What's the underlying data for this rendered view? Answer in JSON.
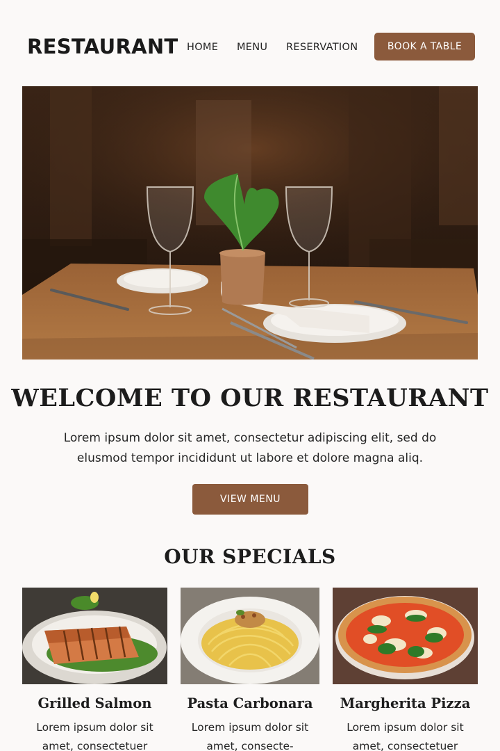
{
  "header": {
    "logo": "RESTAURANT",
    "nav": {
      "home": "HOME",
      "menu": "MENU",
      "reservation": "RESERVATION"
    },
    "book_label": "BOOK A TABLE"
  },
  "welcome": {
    "title": "WELCOME TO OUR RESTAURANT",
    "text": "Lorem ipsum dolor sit amet, consectetur adipiscing elit, sed do elusmod tempor incididunt ut labore et dolore magna aliq.",
    "button": "VIEW MENU"
  },
  "specials": {
    "title": "OUR SPECIALS",
    "items": [
      {
        "name": "Grilled Salmon",
        "desc": "Lorem ipsum dolor sit amet, consectetuer"
      },
      {
        "name": "Pasta Carbonara",
        "desc": "Lorem ipsum dolor sit amet, consecte-"
      },
      {
        "name": "Margherita Pizza",
        "desc": "Lorem ipsum dolor sit amet, consectetuer"
      }
    ]
  },
  "colors": {
    "accent": "#8b5a3c",
    "background": "#fbf9f8",
    "text": "#1e1e1e"
  }
}
